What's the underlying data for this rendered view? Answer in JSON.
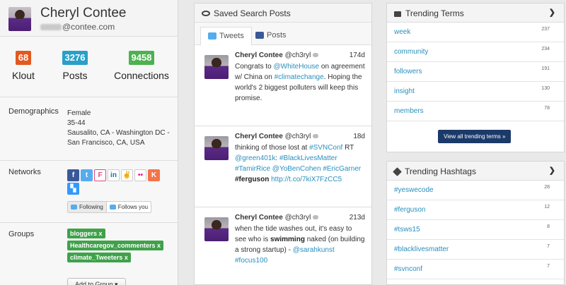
{
  "profile": {
    "name": "Cheryl Contee",
    "email_visible": "@contee.com",
    "stats": [
      {
        "value": "68",
        "label": "Klout",
        "color": "#e2581f"
      },
      {
        "value": "3276",
        "label": "Posts",
        "color": "#28a0c8"
      },
      {
        "value": "9458",
        "label": "Connections",
        "color": "#4db150"
      }
    ],
    "demographics_label": "Demographics",
    "demographics": [
      "Female",
      "35-44",
      "Sausalito, CA - Washington DC - San Francisco, CA, USA"
    ],
    "networks_label": "Networks",
    "network_icons": [
      "facebook-icon",
      "twitter-icon",
      "foursquare-icon",
      "linkedin-icon",
      "angellist-icon",
      "flickr-icon",
      "klout-icon",
      "delicious-icon"
    ],
    "following_label": "Following",
    "follows_you_label": "Follows you",
    "groups_label": "Groups",
    "groups": [
      "bloggers x",
      "Healthcaregov_commenters x",
      "climate_Tweeters x"
    ],
    "add_group_label": "Add to Group ▾"
  },
  "posts_panel": {
    "title": "Saved Search Posts",
    "tabs": [
      "Tweets",
      "Posts"
    ],
    "posts": [
      {
        "name": "Cheryl Contee",
        "handle": "@ch3ryl",
        "age": "174d",
        "segments": [
          {
            "t": "Congrats to ",
            "k": "text"
          },
          {
            "t": "@WhiteHouse",
            "k": "link"
          },
          {
            "t": " on agreement w/ China on ",
            "k": "text"
          },
          {
            "t": "#climatechange",
            "k": "link"
          },
          {
            "t": ". Hoping the world's 2 biggest polluters will keep this promise.",
            "k": "text"
          }
        ]
      },
      {
        "name": "Cheryl Contee",
        "handle": "@ch3ryl",
        "age": "18d",
        "segments": [
          {
            "t": "thinking of those lost at ",
            "k": "text"
          },
          {
            "t": "#SVNConf",
            "k": "link"
          },
          {
            "t": " RT ",
            "k": "text"
          },
          {
            "t": "@green401k",
            "k": "link"
          },
          {
            "t": ": ",
            "k": "text"
          },
          {
            "t": "#BlackLivesMatter",
            "k": "link"
          },
          {
            "t": " ",
            "k": "text"
          },
          {
            "t": "#TamirRice",
            "k": "link"
          },
          {
            "t": " ",
            "k": "text"
          },
          {
            "t": "@YoBenCohen",
            "k": "link"
          },
          {
            "t": " ",
            "k": "text"
          },
          {
            "t": "#EricGarner",
            "k": "link"
          },
          {
            "t": " ",
            "k": "text"
          },
          {
            "t": "#ferguson",
            "k": "bold"
          },
          {
            "t": " ",
            "k": "text"
          },
          {
            "t": "http://t.co/7kiX7FzCC5",
            "k": "link"
          }
        ]
      },
      {
        "name": "Cheryl Contee",
        "handle": "@ch3ryl",
        "age": "213d",
        "segments": [
          {
            "t": "when the tide washes out, it's easy to see who is ",
            "k": "text"
          },
          {
            "t": "swimming",
            "k": "bold"
          },
          {
            "t": " naked (on building a strong startup) - ",
            "k": "text"
          },
          {
            "t": "@sarahkunst",
            "k": "link"
          },
          {
            "t": " ",
            "k": "text"
          },
          {
            "t": "#focus100",
            "k": "link"
          }
        ]
      }
    ]
  },
  "trending_terms": {
    "title": "Trending Terms",
    "items": [
      {
        "term": "week",
        "count": "237"
      },
      {
        "term": "community",
        "count": "234"
      },
      {
        "term": "followers",
        "count": "191"
      },
      {
        "term": "insight",
        "count": "130"
      },
      {
        "term": "members",
        "count": "78"
      }
    ],
    "view_all_label": "View all trending terms »"
  },
  "trending_hashtags": {
    "title": "Trending Hashtags",
    "items": [
      {
        "term": "#yeswecode",
        "count": "28"
      },
      {
        "term": "#ferguson",
        "count": "12"
      },
      {
        "term": "#tsws15",
        "count": "8"
      },
      {
        "term": "#blacklivesmatter",
        "count": "7"
      },
      {
        "term": "#svnconf",
        "count": "7"
      }
    ]
  }
}
